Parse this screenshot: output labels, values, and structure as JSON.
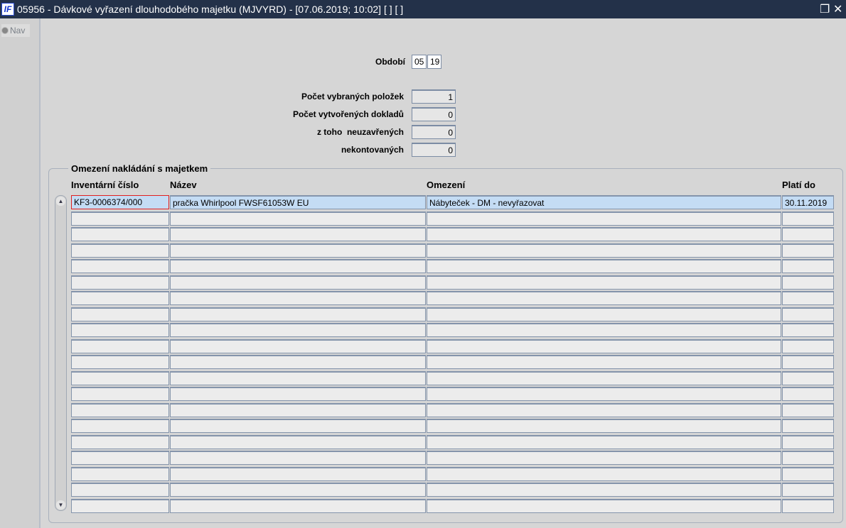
{
  "window": {
    "title": "05956 - Dávkové vyřazení dlouhodobého majetku (MJVYRD) - [07.06.2019; 10:02]  [ ]  [ ]",
    "logo": "IF"
  },
  "nav": {
    "label": "Nav"
  },
  "form": {
    "period_label": "Období",
    "period_month": "05",
    "period_year": "19",
    "selected_label": "Počet vybraných položek",
    "selected_value": "1",
    "created_label": "Počet vytvořených dokladů",
    "created_value": "0",
    "unclosed_label": "z toho  neuzavřených",
    "unclosed_value": "0",
    "unposted_label": "nekontovaných",
    "unposted_value": "0"
  },
  "table": {
    "group_title": "Omezení nakládání s majetkem",
    "headers": [
      "Inventární číslo",
      "Název",
      "Omezení",
      "Platí do"
    ],
    "rows": [
      [
        "KF3-0006374/000",
        "pračka Whirlpool FWSF61053W EU",
        "Nábyteček - DM - nevyřazovat",
        "30.11.2019"
      ],
      [
        "",
        "",
        "",
        ""
      ],
      [
        "",
        "",
        "",
        ""
      ],
      [
        "",
        "",
        "",
        ""
      ],
      [
        "",
        "",
        "",
        ""
      ],
      [
        "",
        "",
        "",
        ""
      ],
      [
        "",
        "",
        "",
        ""
      ],
      [
        "",
        "",
        "",
        ""
      ],
      [
        "",
        "",
        "",
        ""
      ],
      [
        "",
        "",
        "",
        ""
      ],
      [
        "",
        "",
        "",
        ""
      ],
      [
        "",
        "",
        "",
        ""
      ],
      [
        "",
        "",
        "",
        ""
      ],
      [
        "",
        "",
        "",
        ""
      ],
      [
        "",
        "",
        "",
        ""
      ],
      [
        "",
        "",
        "",
        ""
      ],
      [
        "",
        "",
        "",
        ""
      ],
      [
        "",
        "",
        "",
        ""
      ],
      [
        "",
        "",
        "",
        ""
      ],
      [
        "",
        "",
        "",
        ""
      ]
    ]
  }
}
